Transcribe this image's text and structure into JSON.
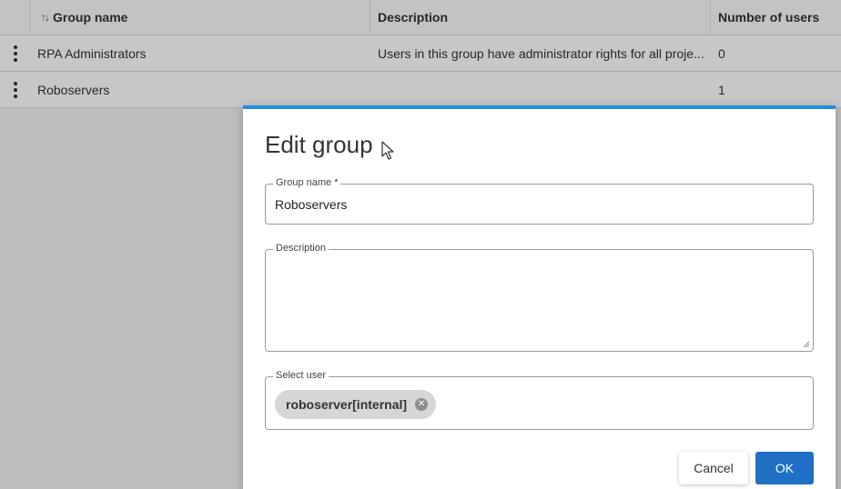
{
  "table": {
    "columns": {
      "sort_icon": "↑↓",
      "name": "Group name",
      "description": "Description",
      "count": "Number of users"
    },
    "rows": [
      {
        "name": "RPA Administrators",
        "description": "Users in this group have administrator rights for all proje...",
        "count": "0"
      },
      {
        "name": "Roboservers",
        "description": "",
        "count": "1"
      }
    ]
  },
  "dialog": {
    "title": "Edit group",
    "accent_color": "#1f8de0",
    "group_name_label": "Group name *",
    "group_name_value": "Roboservers",
    "description_label": "Description",
    "description_value": "",
    "select_user_label": "Select user",
    "selected_users": [
      "roboserver[internal]"
    ],
    "cancel_label": "Cancel",
    "ok_label": "OK",
    "ok_color": "#1f6fc5"
  }
}
